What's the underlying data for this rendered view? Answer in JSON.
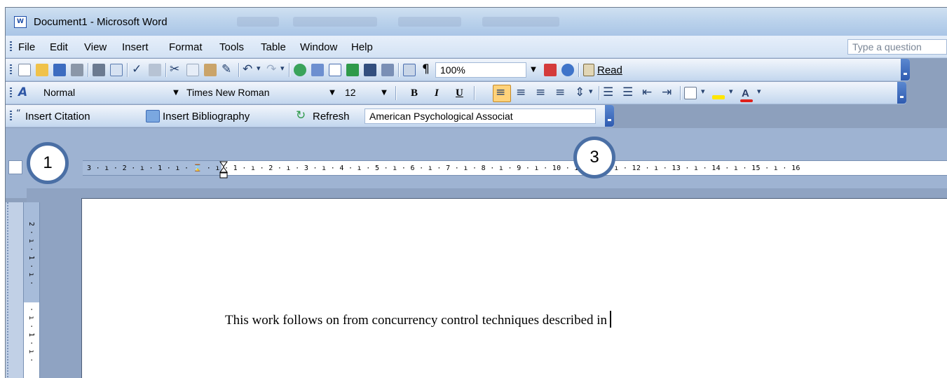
{
  "window": {
    "title": "Document1 - Microsoft Word",
    "app_icon_text": "W"
  },
  "menubar": {
    "items": [
      "File",
      "Edit",
      "View",
      "Insert",
      "Format",
      "Tools",
      "Table",
      "Window",
      "Help"
    ],
    "question_placeholder": "Type a question"
  },
  "standard_toolbar": {
    "zoom": "100%",
    "read_label": "Read"
  },
  "formatting_toolbar": {
    "style": "Normal",
    "font": "Times New Roman",
    "size": "12",
    "bold": "B",
    "italic": "I",
    "underline": "U",
    "font_color_letter": "A"
  },
  "citation_toolbar": {
    "insert_citation": "Insert Citation",
    "insert_bibliography": "Insert Bibliography",
    "refresh": "Refresh",
    "style": "American Psychological Associat"
  },
  "ruler": {
    "text": "3 · ı · 2 · ı · 1 · ı · ⌛ · ı · 1 · ı · 2 · ı · 3 · ı · 4 · ı · 5 · ı · 6 · ı · 7 · ı · 8 · ı · 9 · ı · 10 · ı · 11 · ı · 12 · ı · 13 · ı · 14 · ı · 15 · ı · 16"
  },
  "document": {
    "text": "This work follows on from concurrency control techniques described in"
  },
  "callouts": [
    "1",
    "3"
  ],
  "colors": {
    "accent": "#4a6fa5",
    "toolbar_top": "#f2f6fc",
    "toolbar_bottom": "#c3d6ee"
  }
}
